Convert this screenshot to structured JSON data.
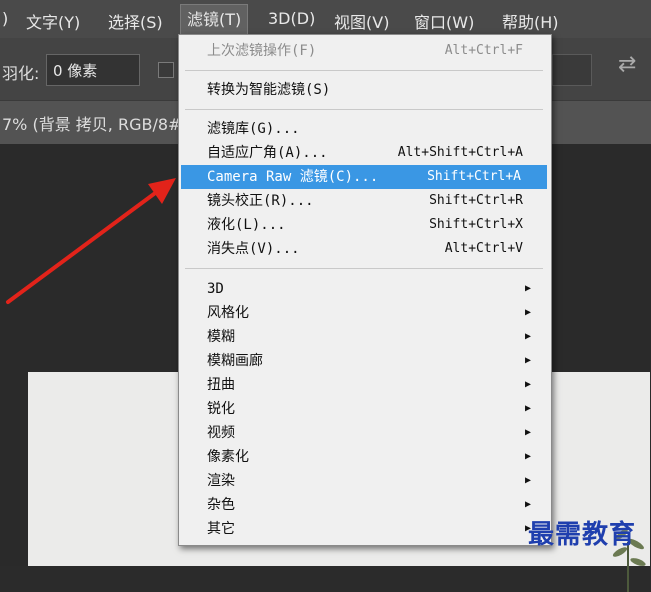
{
  "menubar": {
    "items": [
      ")",
      "文字(Y)",
      "选择(S)",
      "滤镜(T)",
      "3D(D)",
      "视图(V)",
      "窗口(W)",
      "帮助(H)"
    ]
  },
  "options": {
    "feather_label": "羽化:",
    "feather_value": "0 像素",
    "swap_icon": "⇄"
  },
  "doc_tab": {
    "label": "7% (背景 拷贝, RGB/8#"
  },
  "filter_menu": {
    "last_filter": {
      "label": "上次滤镜操作(F)",
      "shortcut": "Alt+Ctrl+F"
    },
    "smart_filter": {
      "label": "转换为智能滤镜(S)"
    },
    "group1": [
      {
        "label": "滤镜库(G)...",
        "shortcut": ""
      },
      {
        "label": "自适应广角(A)...",
        "shortcut": "Alt+Shift+Ctrl+A"
      },
      {
        "label": "Camera Raw 滤镜(C)...",
        "shortcut": "Shift+Ctrl+A"
      },
      {
        "label": "镜头校正(R)...",
        "shortcut": "Shift+Ctrl+R"
      },
      {
        "label": "液化(L)...",
        "shortcut": "Shift+Ctrl+X"
      },
      {
        "label": "消失点(V)...",
        "shortcut": "Alt+Ctrl+V"
      }
    ],
    "submenus": [
      "3D",
      "风格化",
      "模糊",
      "模糊画廊",
      "扭曲",
      "锐化",
      "视频",
      "像素化",
      "渲染",
      "杂色",
      "其它"
    ],
    "highlight_color": "#3a97e4"
  },
  "watermark": "最需教育"
}
